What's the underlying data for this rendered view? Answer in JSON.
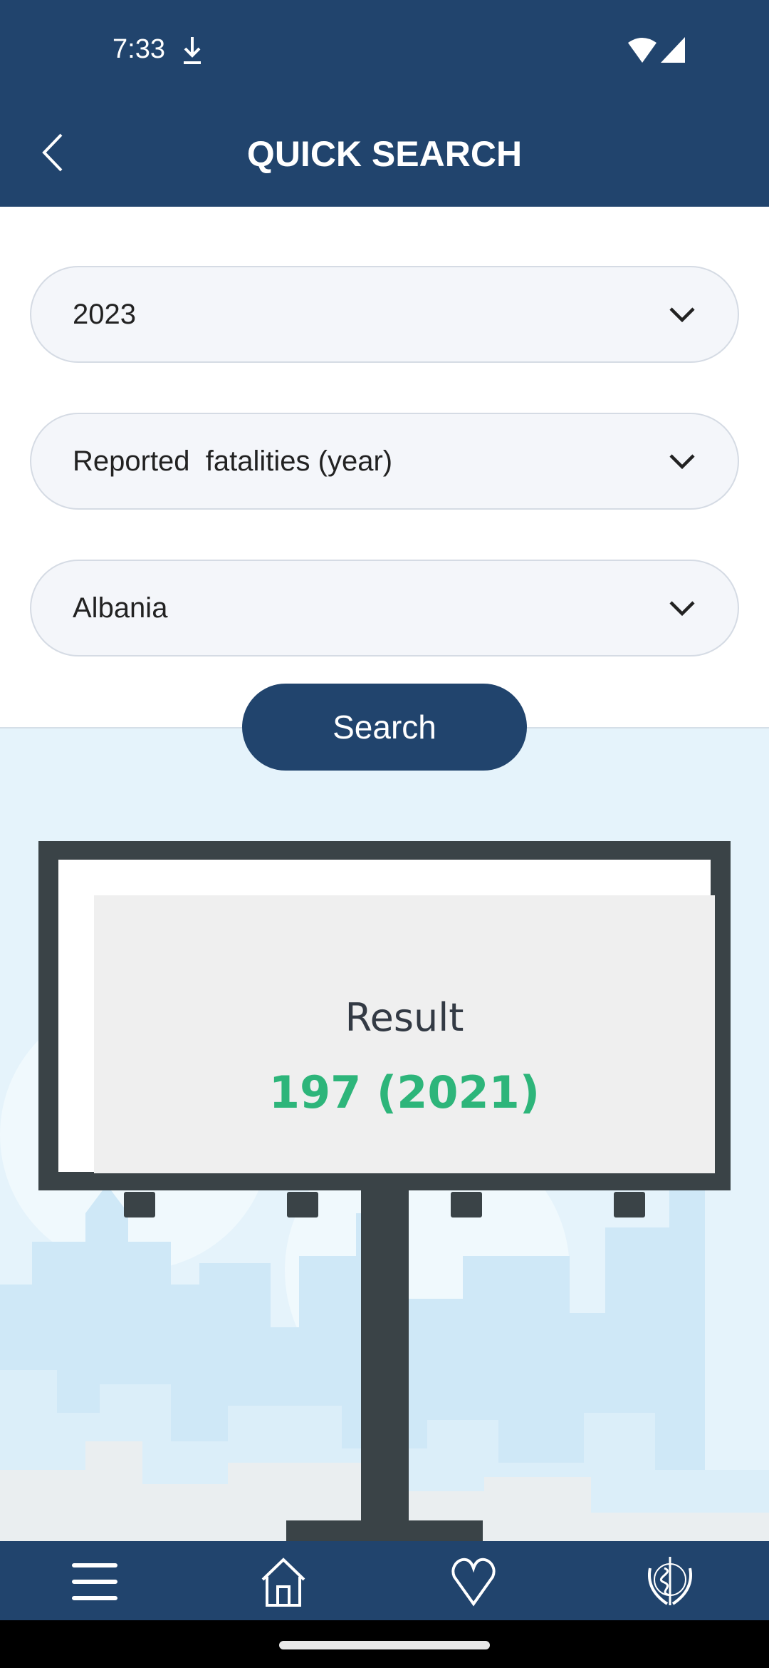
{
  "status_bar": {
    "time": "7:33",
    "icons": [
      "download-icon",
      "wifi-icon",
      "signal-icon"
    ]
  },
  "header": {
    "title": "QUICK SEARCH",
    "back_icon": "chevron-left-icon"
  },
  "filters": {
    "year": "2023",
    "indicator": "Reported  fatalities (year)",
    "country": "Albania"
  },
  "search_label": "Search",
  "result": {
    "label": "Result",
    "value": "197 (2021)",
    "value_color": "#2db57a"
  },
  "bottom_nav": [
    "menu-icon",
    "home-icon",
    "heart-icon",
    "who-emblem-icon"
  ],
  "colors": {
    "brand": "#21446d"
  }
}
